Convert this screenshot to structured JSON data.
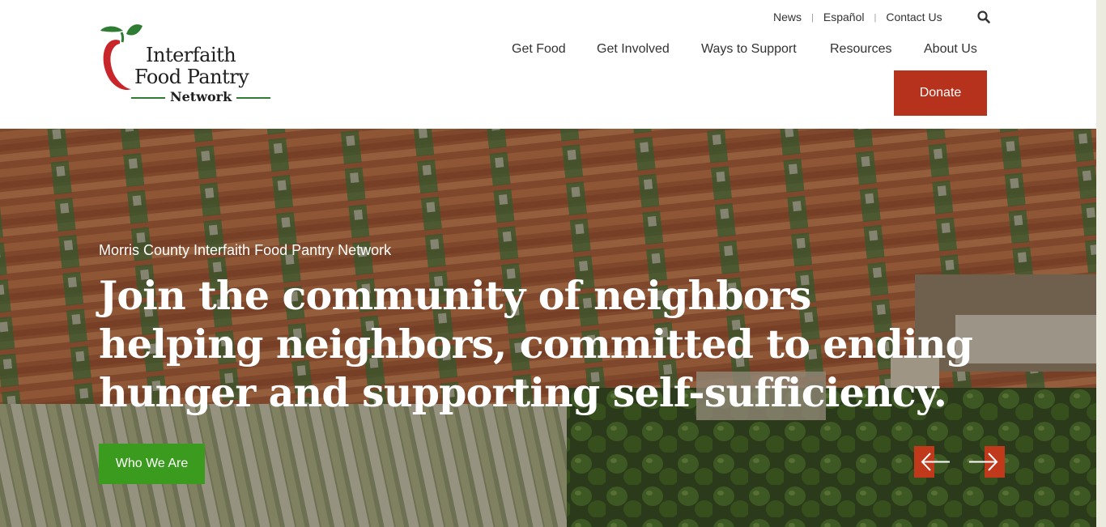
{
  "brand": {
    "line1": "Interfaith",
    "line2": "Food Pantry",
    "line3": "Network",
    "apple_icon": "apple-logo-icon",
    "colors": {
      "red": "#c8262b",
      "green": "#2f7d32"
    }
  },
  "utility_nav": {
    "items": [
      "News",
      "Español",
      "Contact Us"
    ],
    "separator": "|",
    "search_icon": "search-icon"
  },
  "main_nav": {
    "items": [
      "Get Food",
      "Get Involved",
      "Ways to Support",
      "Resources",
      "About Us"
    ],
    "donate_label": "Donate"
  },
  "hero": {
    "kicker": "Morris County Interfaith Food Pantry Network",
    "heading": "Join the community of neighbors helping neighbors, committed to ending hunger and supporting self-sufficiency.",
    "cta_label": "Who We Are",
    "prev_icon": "arrow-left-icon",
    "next_icon": "arrow-right-icon"
  },
  "colors": {
    "donate": "#b7321c",
    "cta": "#3b9b1e",
    "arrow_accent": "#c0391b",
    "text": "#333333"
  }
}
